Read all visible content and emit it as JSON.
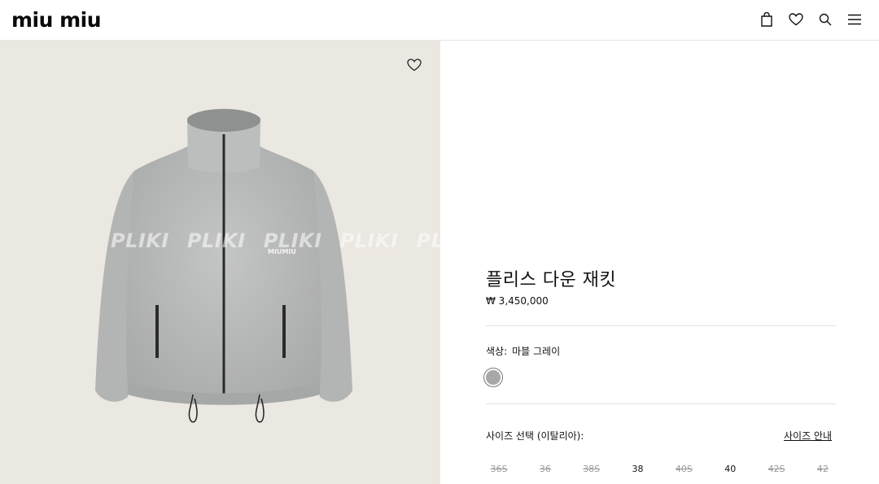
{
  "header": {
    "logo": "miu miu",
    "icons": [
      "bag-icon",
      "heart-icon",
      "search-icon",
      "menu-icon"
    ]
  },
  "image": {
    "watermark": [
      "PLIKI",
      "PLIKI",
      "PLIKI",
      "PLIKI",
      "PLIKI"
    ],
    "jacket_logo": "MIUMIU"
  },
  "product": {
    "title": "플리스 다운 재킷",
    "price": "₩ 3,450,000",
    "color_label": "색상:",
    "color_value": "마블 그레이",
    "swatch_color": "#a8a8a8",
    "size_label": "사이즈 선택 (이탈리아):",
    "size_guide": "사이즈 안내",
    "sizes": [
      {
        "label": "36S",
        "available": false
      },
      {
        "label": "36",
        "available": false
      },
      {
        "label": "38S",
        "available": false
      },
      {
        "label": "38",
        "available": true
      },
      {
        "label": "40S",
        "available": false
      },
      {
        "label": "40",
        "available": true
      },
      {
        "label": "42S",
        "available": false
      },
      {
        "label": "42",
        "available": false
      }
    ]
  },
  "colors": {
    "image_bg": "#ebe7e1",
    "jacket": "#bfc0c0",
    "text": "#111111"
  }
}
